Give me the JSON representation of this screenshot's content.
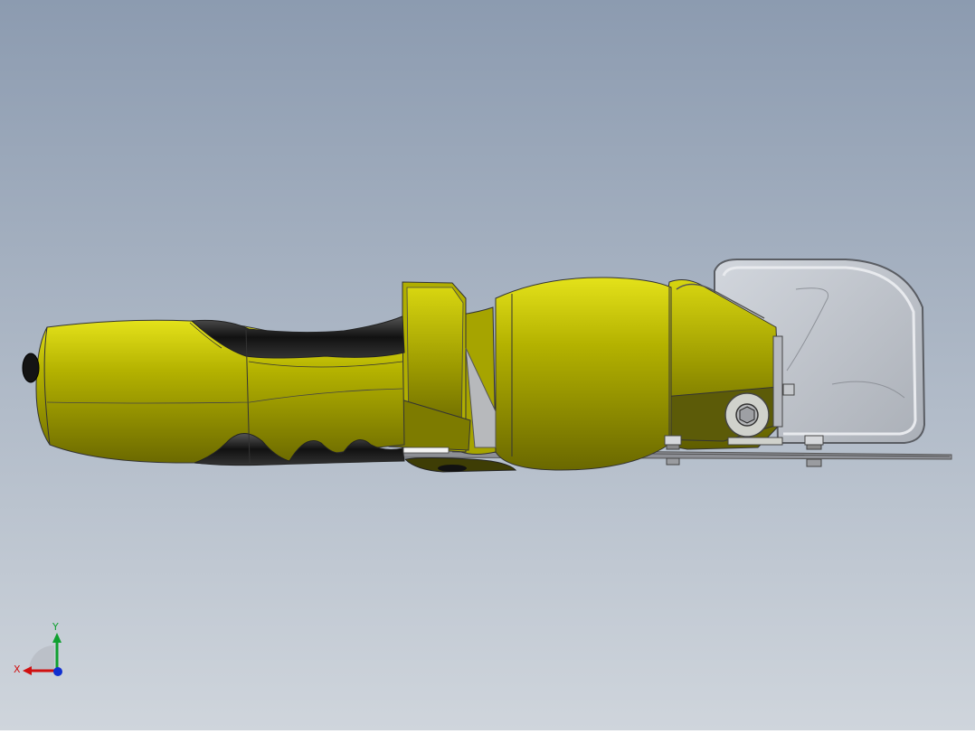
{
  "viewport": {
    "background_top": "#8c9bb0",
    "background_bottom": "#cfd5dc",
    "model_colors": {
      "body_yellow": "#c8c600",
      "body_shade": "#6e6c00",
      "grip_black": "#1a1a1a",
      "guard_grey": "#c8cbd0",
      "plate_grey": "#9a9aa0"
    }
  },
  "triad": {
    "x_label": "X",
    "y_label": "Y",
    "x_color": "#d01010",
    "y_color": "#10a030",
    "z_color": "#1030d0"
  }
}
